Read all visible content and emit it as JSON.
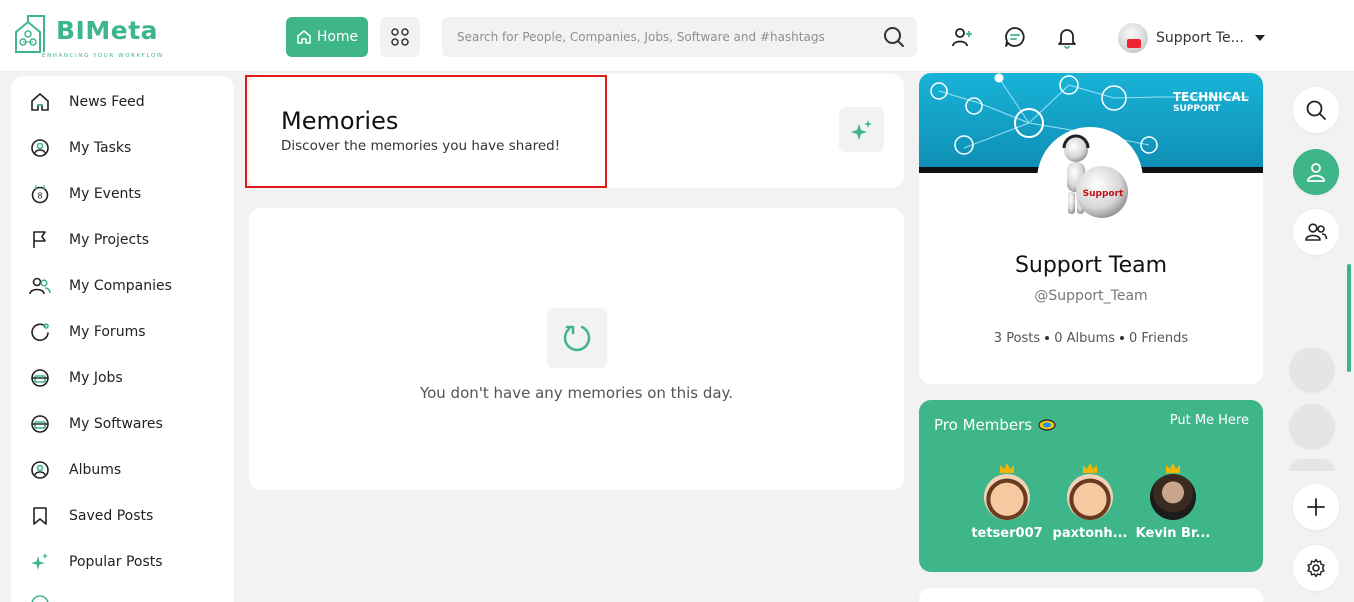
{
  "header": {
    "logo_text": "BIMeta",
    "logo_tagline": "ENHANCING YOUR WORKFLOW",
    "home_label": "Home",
    "search_placeholder": "Search for People, Companies, Jobs, Software and #hashtags",
    "user_name": "Support Te..."
  },
  "sidebar": {
    "items": [
      {
        "label": "News Feed",
        "icon": "home-icon"
      },
      {
        "label": "My Tasks",
        "icon": "tasks-icon"
      },
      {
        "label": "My Events",
        "icon": "calendar-icon"
      },
      {
        "label": "My Projects",
        "icon": "flag-icon"
      },
      {
        "label": "My Companies",
        "icon": "users-icon"
      },
      {
        "label": "My Forums",
        "icon": "forum-icon"
      },
      {
        "label": "My Jobs",
        "icon": "briefcase-icon"
      },
      {
        "label": "My Softwares",
        "icon": "software-icon"
      },
      {
        "label": "Albums",
        "icon": "album-icon"
      },
      {
        "label": "Saved Posts",
        "icon": "bookmark-icon"
      },
      {
        "label": "Popular Posts",
        "icon": "sparkle-icon"
      }
    ]
  },
  "memories": {
    "title": "Memories",
    "subtitle": "Discover the memories you have shared!",
    "empty_text": "You don't have any memories on this day."
  },
  "profile": {
    "banner_title": "TECHNICAL",
    "banner_subtitle": "SUPPORT",
    "avatar_badge": "Support",
    "name": "Support Team",
    "handle": "@Support_Team",
    "posts": "3 Posts",
    "albums": "0 Albums",
    "friends": "0 Friends"
  },
  "pro_members": {
    "title": "Pro Members",
    "link": "Put Me Here",
    "members": [
      {
        "name": "tetser007"
      },
      {
        "name": "paxtonh..."
      },
      {
        "name": "Kevin Br..."
      }
    ]
  },
  "colors": {
    "accent": "#3fb58a",
    "highlight_border": "#e0191b"
  }
}
